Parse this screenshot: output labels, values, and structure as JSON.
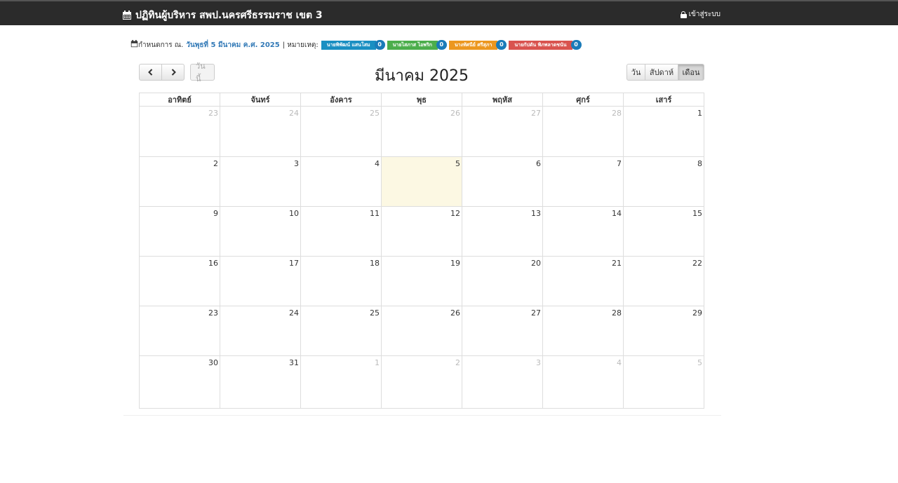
{
  "navbar": {
    "brand_title": "ปฏิทินผู้บริหาร สพป.นครศรีธรรมราช เขต 3",
    "brand_icon": "calendar-icon",
    "login_label": "เข้าสู่ระบบ",
    "login_icon": "lock-icon"
  },
  "info": {
    "prefix": "กำหนดการ ณ.",
    "date": "วันพุธที่ 5 มีนาคม ค.ศ. 2025",
    "note_label": "| หมายเหตุ:",
    "legend": [
      {
        "label": "นายพิพัฒน์ แสนโสม",
        "count": "0",
        "color": "#1a8fc2"
      },
      {
        "label": "นายไสภาส ไอพริก",
        "count": "0",
        "color": "#4cae4c"
      },
      {
        "label": "นางทัศนีย์ ศรีสุภา",
        "count": "0",
        "color": "#ec971f"
      },
      {
        "label": "นายกัปตัน พิภพลาดชนัน",
        "count": "0",
        "color": "#d9534f"
      }
    ]
  },
  "toolbar": {
    "prev_icon": "chevron-left-icon",
    "next_icon": "chevron-right-icon",
    "today_label": "วันนี้",
    "title": "มีนาคม 2025",
    "views": [
      "วัน",
      "สัปดาห์",
      "เดือน"
    ],
    "active_view": "เดือน"
  },
  "calendar": {
    "weekdays": [
      "อาทิตย์",
      "จันทร์",
      "อังคาร",
      "พุธ",
      "พฤหัส",
      "ศุกร์",
      "เสาร์"
    ],
    "weeks": [
      [
        "23",
        "24",
        "25",
        "26",
        "27",
        "28",
        "1"
      ],
      [
        "2",
        "3",
        "4",
        "5",
        "6",
        "7",
        "8"
      ],
      [
        "9",
        "10",
        "11",
        "12",
        "13",
        "14",
        "15"
      ],
      [
        "16",
        "17",
        "18",
        "19",
        "20",
        "21",
        "22"
      ],
      [
        "23",
        "24",
        "25",
        "26",
        "27",
        "28",
        "29"
      ],
      [
        "30",
        "31",
        "1",
        "2",
        "3",
        "4",
        "5"
      ]
    ],
    "today": "5"
  }
}
